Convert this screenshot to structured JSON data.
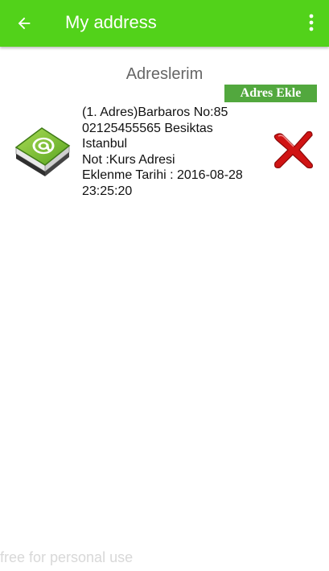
{
  "appbar": {
    "back_icon": "arrow-back-icon",
    "title": "My address",
    "menu_icon": "more-vert-icon",
    "color": "#52d21a"
  },
  "section": {
    "title": "Adreslerim",
    "add_button_label": "Adres Ekle",
    "add_button_color": "#52a83e"
  },
  "addresses": [
    {
      "icon": "email-book-icon",
      "lines": [
        "(1. Adres)Barbaros No:85",
        "02125455565 Besiktas",
        "Istanbul",
        "Not :Kurs Adresi",
        "Eklenme Tarihi : 2016-08-28",
        "23:25:20"
      ],
      "delete_icon": "red-x-delete-icon"
    }
  ],
  "watermark": "free for personal use"
}
